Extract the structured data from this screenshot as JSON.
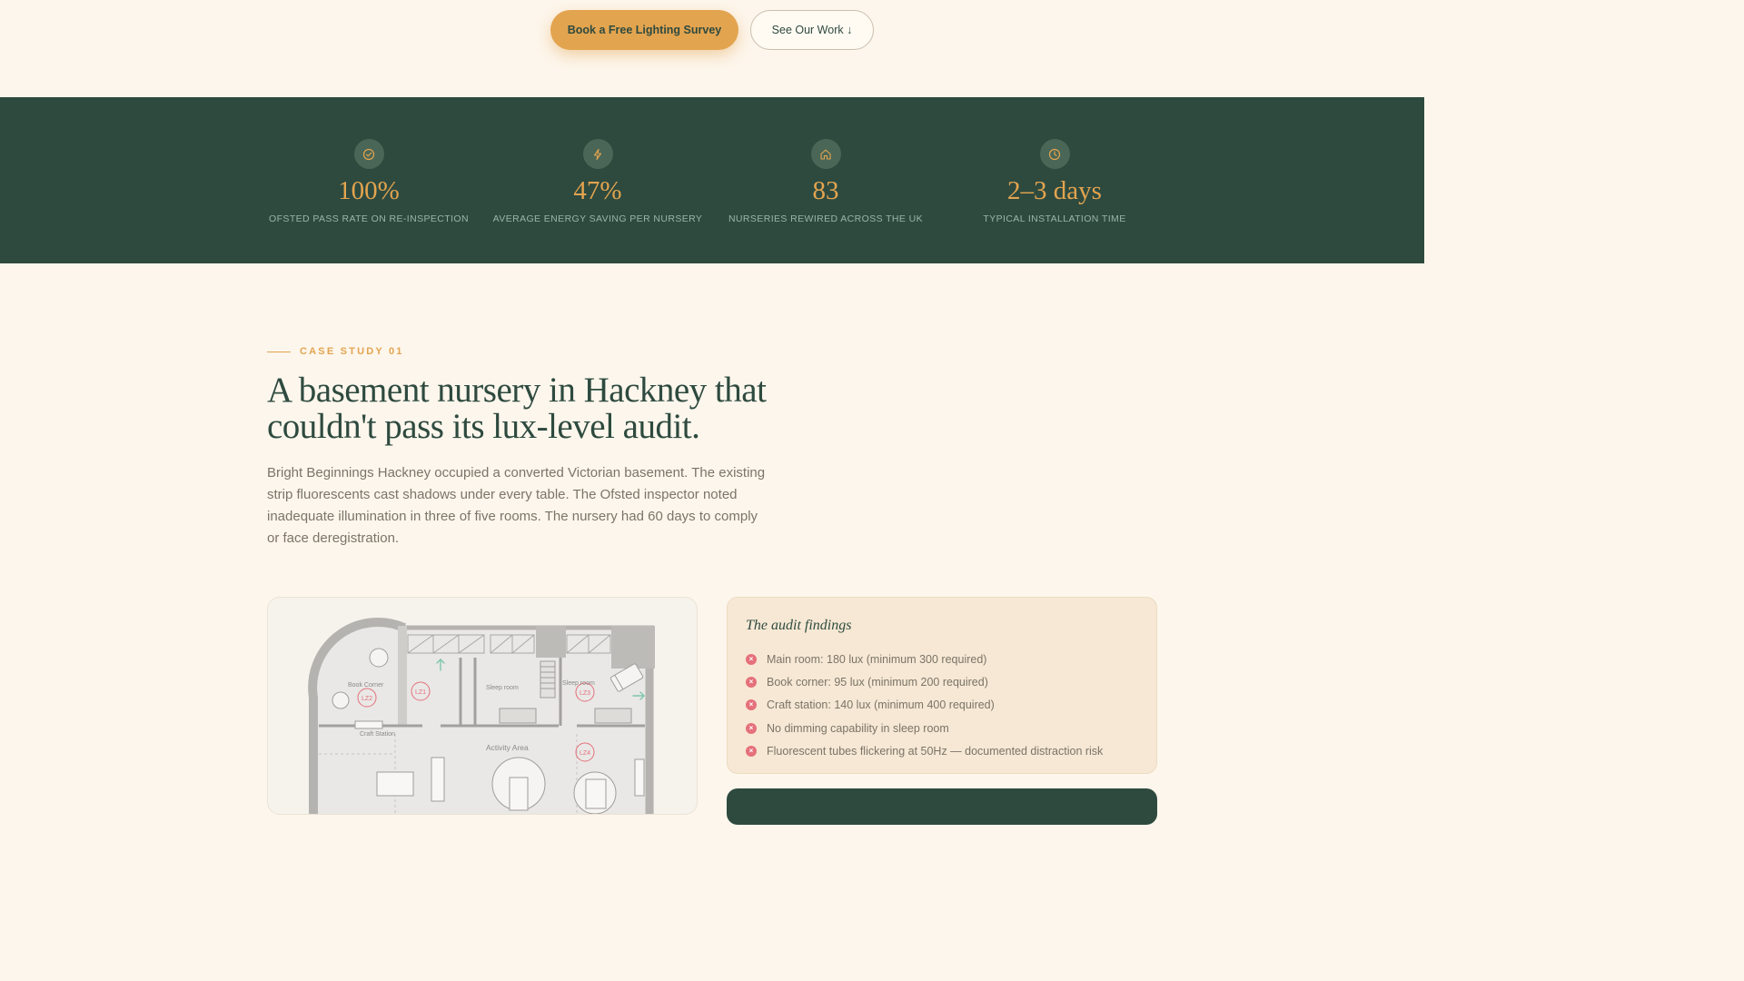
{
  "hero": {
    "primary_cta": "Book a Free Lighting Survey",
    "secondary_cta": "See Our Work ↓"
  },
  "stats": [
    {
      "icon": "check-circle-icon",
      "value": "100%",
      "label": "OFSTED PASS RATE ON RE-INSPECTION"
    },
    {
      "icon": "lightning-bolt-icon",
      "value": "47%",
      "label": "AVERAGE ENERGY SAVING PER NURSERY"
    },
    {
      "icon": "house-icon",
      "value": "83",
      "label": "NURSERIES REWIRED ACROSS THE UK"
    },
    {
      "icon": "clock-icon",
      "value": "2–3 days",
      "label": "TYPICAL INSTALLATION TIME"
    }
  ],
  "case_study": {
    "eyebrow": "CASE STUDY 01",
    "title": "A basement nursery in Hackney that couldn't pass its lux-level audit.",
    "body": "Bright Beginnings Hackney occupied a converted Victorian basement. The existing strip fluorescents cast shadows under every table. The Ofsted inspector noted inadequate illumination in three of five rooms. The nursery had 60 days to comply or face deregistration."
  },
  "floor_plan": {
    "rooms": [
      "Book Corner",
      "Sleep room",
      "Sleep room",
      "Craft Station",
      "Activity Area"
    ],
    "zones": [
      "LZ1",
      "LZ2",
      "LZ3",
      "LZ4"
    ]
  },
  "findings": {
    "title": "The audit findings",
    "items": [
      "Main room: 180 lux (minimum 300 required)",
      "Book corner: 95 lux (minimum 200 required)",
      "Craft station: 140 lux (minimum 400 required)",
      "No dimming capability in sleep room",
      "Fluorescent tubes flickering at 50Hz — documented distraction risk"
    ]
  },
  "colors": {
    "forest": "#2e4a3f",
    "amber": "#e3a44f",
    "cream": "#fdf6ec",
    "alert": "#e5707b"
  }
}
